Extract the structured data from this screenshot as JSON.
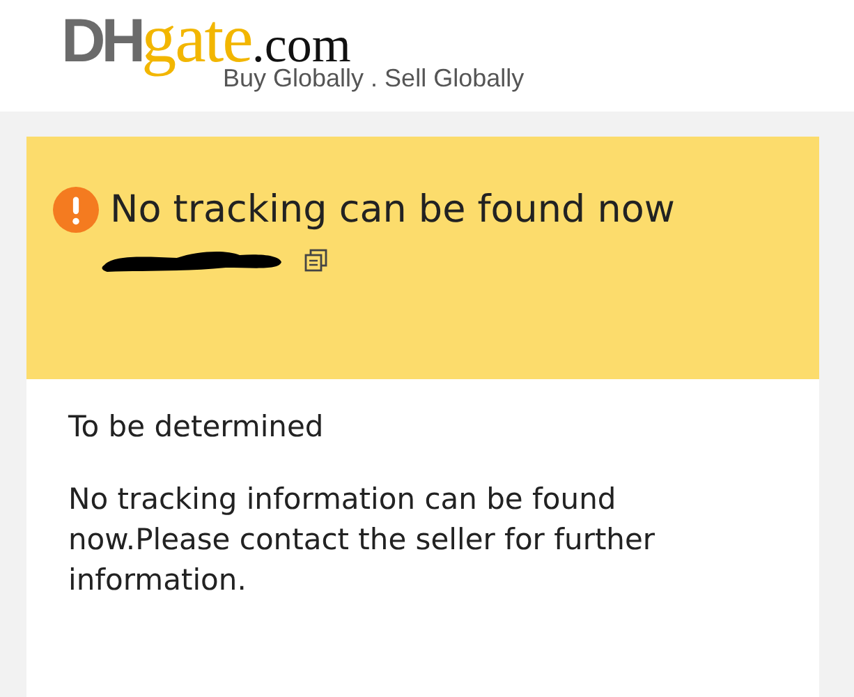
{
  "header": {
    "logo": {
      "brand": "DH",
      "accent": "gate",
      "suffix": ".com"
    },
    "tagline": "Buy Globally . Sell Globally"
  },
  "alert": {
    "title": "No tracking can be found now",
    "tracking_number_redacted": true
  },
  "status": "To be determined",
  "message": "No tracking information can be found now.Please contact the seller for further information."
}
